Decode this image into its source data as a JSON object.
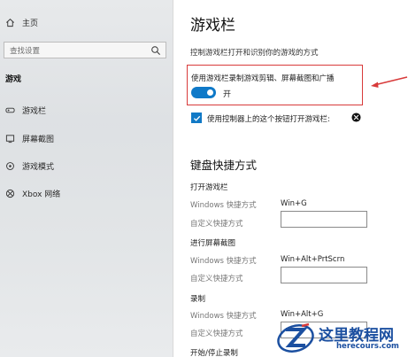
{
  "sidebar": {
    "home_label": "主页",
    "search_placeholder": "查找设置",
    "section_title": "游戏",
    "items": [
      {
        "label": "游戏栏",
        "icon": "gamebar-icon"
      },
      {
        "label": "屏幕截图",
        "icon": "screenshot-icon"
      },
      {
        "label": "游戏模式",
        "icon": "gamemode-icon"
      },
      {
        "label": "Xbox 网络",
        "icon": "xbox-icon"
      }
    ]
  },
  "main": {
    "title": "游戏栏",
    "subtitle": "控制游戏栏打开和识别你的游戏的方式",
    "record_setting": {
      "label": "使用游戏栏录制游戏剪辑、屏幕截图和广播",
      "toggle_state": "开",
      "toggle_on": true
    },
    "controller_checkbox": {
      "label": "使用控制器上的这个按钮打开游戏栏:",
      "checked": true
    },
    "keyboard_shortcuts": {
      "title": "键盘快捷方式",
      "groups": [
        {
          "title": "打开游戏栏",
          "windows_label": "Windows 快捷方式",
          "windows_value": "Win+G",
          "custom_label": "自定义快捷方式",
          "custom_value": ""
        },
        {
          "title": "进行屏幕截图",
          "windows_label": "Windows 快捷方式",
          "windows_value": "Win+Alt+PrtScrn",
          "custom_label": "自定义快捷方式",
          "custom_value": ""
        },
        {
          "title": "录制",
          "windows_label": "Windows 快捷方式",
          "windows_value": "Win+Alt+G",
          "custom_label": "自定义快捷方式",
          "custom_value": ""
        },
        {
          "title": "开始/停止录制"
        }
      ]
    }
  },
  "watermark": {
    "title": "这里教程网",
    "url": "herecours.com"
  },
  "colors": {
    "accent": "#0f79c8",
    "highlight_border": "#d83b3b",
    "watermark": "#1b4fa0"
  }
}
